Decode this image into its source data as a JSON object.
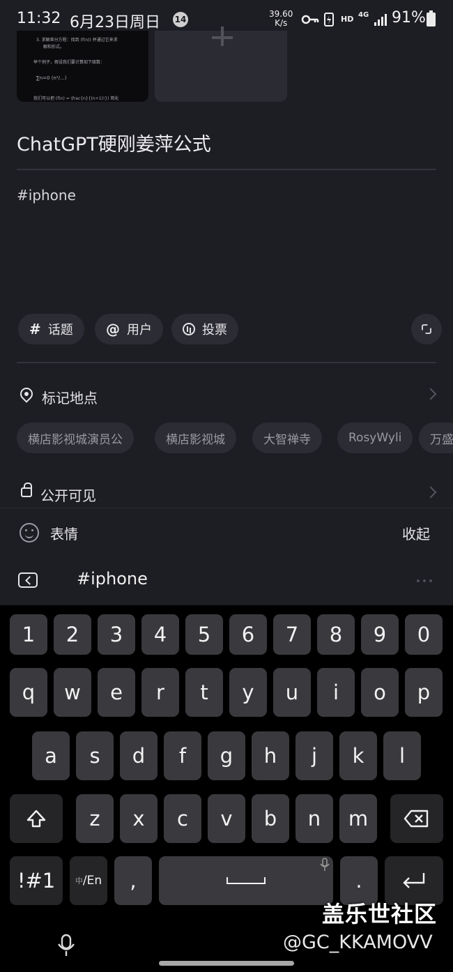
{
  "status_bar": {
    "time": "11:32",
    "date": "6月23日周日",
    "notification_count": "14",
    "net_speed_value": "39.60",
    "net_speed_unit": "K/s",
    "hd": "HD",
    "network": "4G",
    "battery": "91%"
  },
  "post": {
    "title": "ChatGPT硬刚姜萍公式",
    "body": "#iphone"
  },
  "image_preview": {
    "line1": "3. 求解差分方程：找到 (f(n)) 并通过它来求",
    "line2": "解和形式。",
    "line3": "举个例子，假设我们要计算如下级数：",
    "line4": "∑n=0 (n²/...)",
    "line5": "我们可以把 (f(n) = \\frac{n}{(n+1)!}) 简化"
  },
  "toolbar": {
    "topic_symbol": "#",
    "topic_label": "话题",
    "user_symbol": "@",
    "user_label": "用户",
    "vote_label": "投票"
  },
  "location": {
    "label": "标记地点",
    "suggestions": [
      "横店影视城演员公",
      "横店影视城",
      "大智禅寺",
      "RosyWyli",
      "万盛"
    ]
  },
  "visibility": {
    "label": "公开可见"
  },
  "emoji_bar": {
    "label": "表情",
    "collapse": "收起"
  },
  "suggestion_bar": {
    "word": "#iphone"
  },
  "keyboard": {
    "row_numbers": [
      "1",
      "2",
      "3",
      "4",
      "5",
      "6",
      "7",
      "8",
      "9",
      "0"
    ],
    "row_1": [
      "q",
      "w",
      "e",
      "r",
      "t",
      "y",
      "u",
      "i",
      "o",
      "p"
    ],
    "row_2": [
      "a",
      "s",
      "d",
      "f",
      "g",
      "h",
      "j",
      "k",
      "l"
    ],
    "row_3": [
      "z",
      "x",
      "c",
      "v",
      "b",
      "n",
      "m"
    ],
    "symbols_key": "!#1",
    "lang_key_small": "中",
    "lang_key": "/En",
    "comma": ",",
    "period": "."
  },
  "watermark": {
    "site": "盖乐世社区",
    "handle": "@GC_KKAMOVV"
  }
}
